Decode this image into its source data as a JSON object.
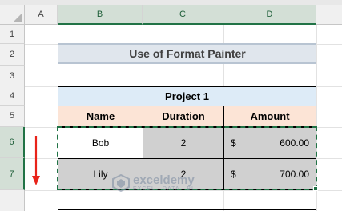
{
  "columns": [
    "A",
    "B",
    "C",
    "D"
  ],
  "rows": [
    "1",
    "2",
    "3",
    "4",
    "5",
    "6",
    "7"
  ],
  "title": "Use of Format Painter",
  "table": {
    "project": "Project 1",
    "headers": [
      "Name",
      "Duration",
      "Amount"
    ],
    "records": [
      {
        "name": "Bob",
        "duration": "2",
        "currency": "$",
        "amount": "600.00"
      },
      {
        "name": "Lily",
        "duration": "2",
        "currency": "$",
        "amount": "700.00"
      }
    ]
  },
  "watermark": {
    "name": "exceldemy",
    "tagline": "EXCEL · DATA · BI"
  },
  "colors": {
    "accent": "#217346",
    "header_fill": "#fce4d6",
    "project_fill": "#ddebf7",
    "copied_fill": "#d0d0d0",
    "arrow": "#e8231a"
  }
}
